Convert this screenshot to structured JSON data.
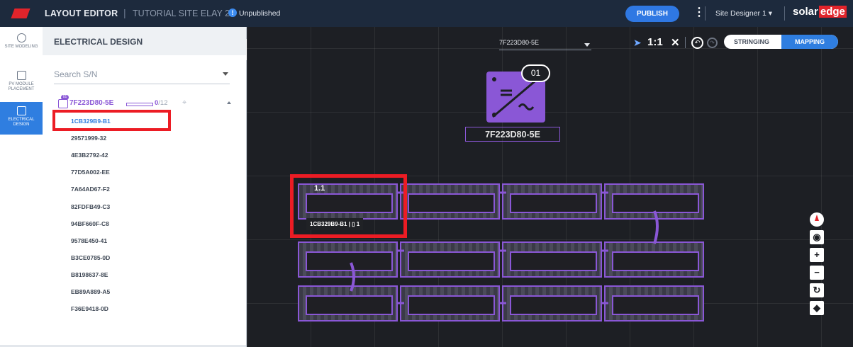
{
  "header": {
    "app_title": "LAYOUT EDITOR",
    "separator": "|",
    "site_name": "TUTORIAL SITE ELAY 2",
    "status": "Unpublished",
    "info_glyph": "!",
    "publish_label": "PUBLISH",
    "user_menu": "Site Designer 1 ▾",
    "brand_text": "solar",
    "brand_edge": "edge"
  },
  "sidebar": {
    "items": [
      {
        "label": "SITE MODELING",
        "icon": "cube-icon"
      },
      {
        "label": "PV MODULE PLACEMENT",
        "icon": "panel-grid-icon"
      },
      {
        "label": "ELECTRICAL DESIGN",
        "icon": "electrical-icon",
        "active": true
      }
    ]
  },
  "panel": {
    "title": "ELECTRICAL DESIGN",
    "search_placeholder": "Search S/N",
    "inverter": {
      "badge": "01",
      "label": "7F223D80-5E",
      "assigned": "0",
      "total": "/12",
      "progress": 0
    },
    "serials": [
      "1CB329B9-B1",
      "29571999-32",
      "4E3B2792-42",
      "77D5A002-EE",
      "7A64AD67-F2",
      "82FDFB49-C3",
      "94BF660F-C8",
      "9578E450-41",
      "B3CE0785-0D",
      "B8198637-8E",
      "EB89A889-A5",
      "F36E9418-0D"
    ],
    "selected_index": 0
  },
  "canvas": {
    "inverter_select": "7F223D80-5E",
    "scale": "1:1",
    "close_glyph": "✕",
    "mode_stringing": "STRINGING",
    "mode_mapping": "MAPPING",
    "inverter_number": "01",
    "inverter_label": "7F223D80-5E",
    "string_label": "1.1",
    "tooltip_text": "1CB329B9-B1 | ▯ 1",
    "map_controls": {
      "zoom_in": "+",
      "zoom_out": "−"
    }
  },
  "colors": {
    "accent_blue": "#2f7ee0",
    "inverter_purple": "#8a57d6",
    "highlight_red": "#ec1c24",
    "topbar": "#1d2a3d",
    "canvas": "#1d1f24"
  }
}
